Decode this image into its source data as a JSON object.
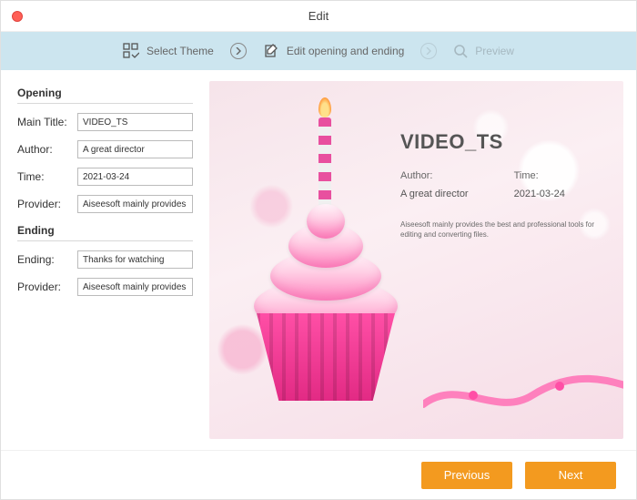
{
  "window": {
    "title": "Edit"
  },
  "steps": {
    "theme": "Select Theme",
    "edit": "Edit opening and ending",
    "preview": "Preview"
  },
  "opening": {
    "section": "Opening",
    "main_title_label": "Main Title:",
    "main_title_value": "VIDEO_TS",
    "author_label": "Author:",
    "author_value": "A great director",
    "time_label": "Time:",
    "time_value": "2021-03-24",
    "provider_label": "Provider:",
    "provider_value": "Aiseesoft mainly provides the best and professional tools for editing and converting files."
  },
  "ending": {
    "section": "Ending",
    "ending_label": "Ending:",
    "ending_value": "Thanks for watching",
    "provider_label": "Provider:",
    "provider_value": "Aiseesoft mainly provides the best and professional tools for editing and converting files."
  },
  "preview": {
    "main_title": "VIDEO_TS",
    "author_label": "Author:",
    "author_value": "A great director",
    "time_label": "Time:",
    "time_value": "2021-03-24",
    "provider_text": "Aiseesoft mainly provides the best and professional tools for editing and converting files."
  },
  "footer": {
    "previous": "Previous",
    "next": "Next"
  }
}
